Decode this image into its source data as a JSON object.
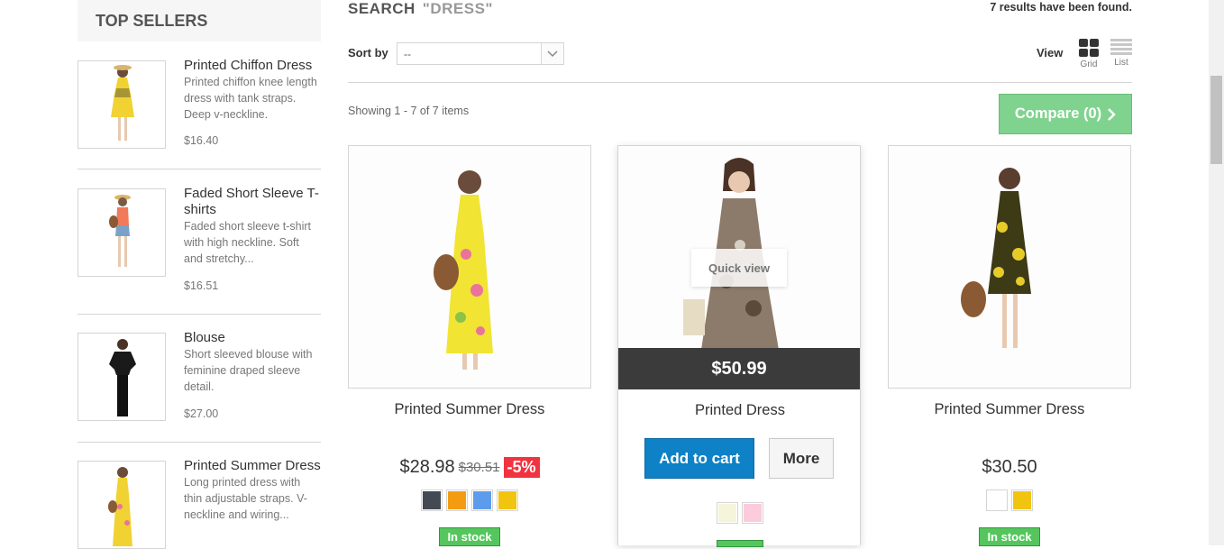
{
  "sidebar": {
    "title": "TOP SELLERS",
    "items": [
      {
        "name": "Printed Chiffon Dress",
        "description": "Printed chiffon knee length dress with tank straps. Deep v-neckline.",
        "price": "$16.40"
      },
      {
        "name": "Faded Short Sleeve T-shirts",
        "description": "Faded short sleeve t-shirt with high neckline. Soft and stretchy...",
        "price": "$16.51"
      },
      {
        "name": "Blouse",
        "description": "Short sleeved blouse with feminine draped sleeve detail.",
        "price": "$27.00"
      },
      {
        "name": "Printed Summer Dress",
        "description": "Long printed dress with thin adjustable straps. V-neckline and wiring...",
        "price": ""
      }
    ]
  },
  "search": {
    "title": "SEARCH",
    "query": "\"DRESS\"",
    "results_text": "7 results have been found."
  },
  "toolbar": {
    "sort_label": "Sort by",
    "sort_value": "--",
    "view_label": "View",
    "grid_label": "Grid",
    "list_label": "List",
    "showing": "Showing 1 - 7 of 7 items",
    "compare_label": "Compare (0)"
  },
  "products": [
    {
      "name": "Printed Summer Dress",
      "price": "$28.98",
      "old_price": "$30.51",
      "discount": "-5%",
      "stock": "In stock",
      "colors": [
        "#434a54",
        "#f39c11",
        "#5d9cec",
        "#f1c40f"
      ]
    },
    {
      "name": "Printed Dress",
      "price": "$50.99",
      "quick_view": "Quick view",
      "add_to_cart": "Add to cart",
      "more": "More",
      "colors": [
        "#f5f5dc",
        "#fcccdc"
      ]
    },
    {
      "name": "Printed Summer Dress",
      "price": "$30.50",
      "stock": "In stock",
      "colors": [
        "#ffffff",
        "#f1c40f"
      ]
    }
  ],
  "icons": {
    "view_grid": "grid-view-icon",
    "view_list": "list-view-icon",
    "compare_arrow": "chevron-right-icon",
    "select_arrow": "chevron-down-icon"
  },
  "colors": {
    "compare_bg": "#80d38f",
    "cart_bg": "#0f81c6",
    "discount_bg": "#f13340",
    "stock_bg": "#55c65e"
  }
}
